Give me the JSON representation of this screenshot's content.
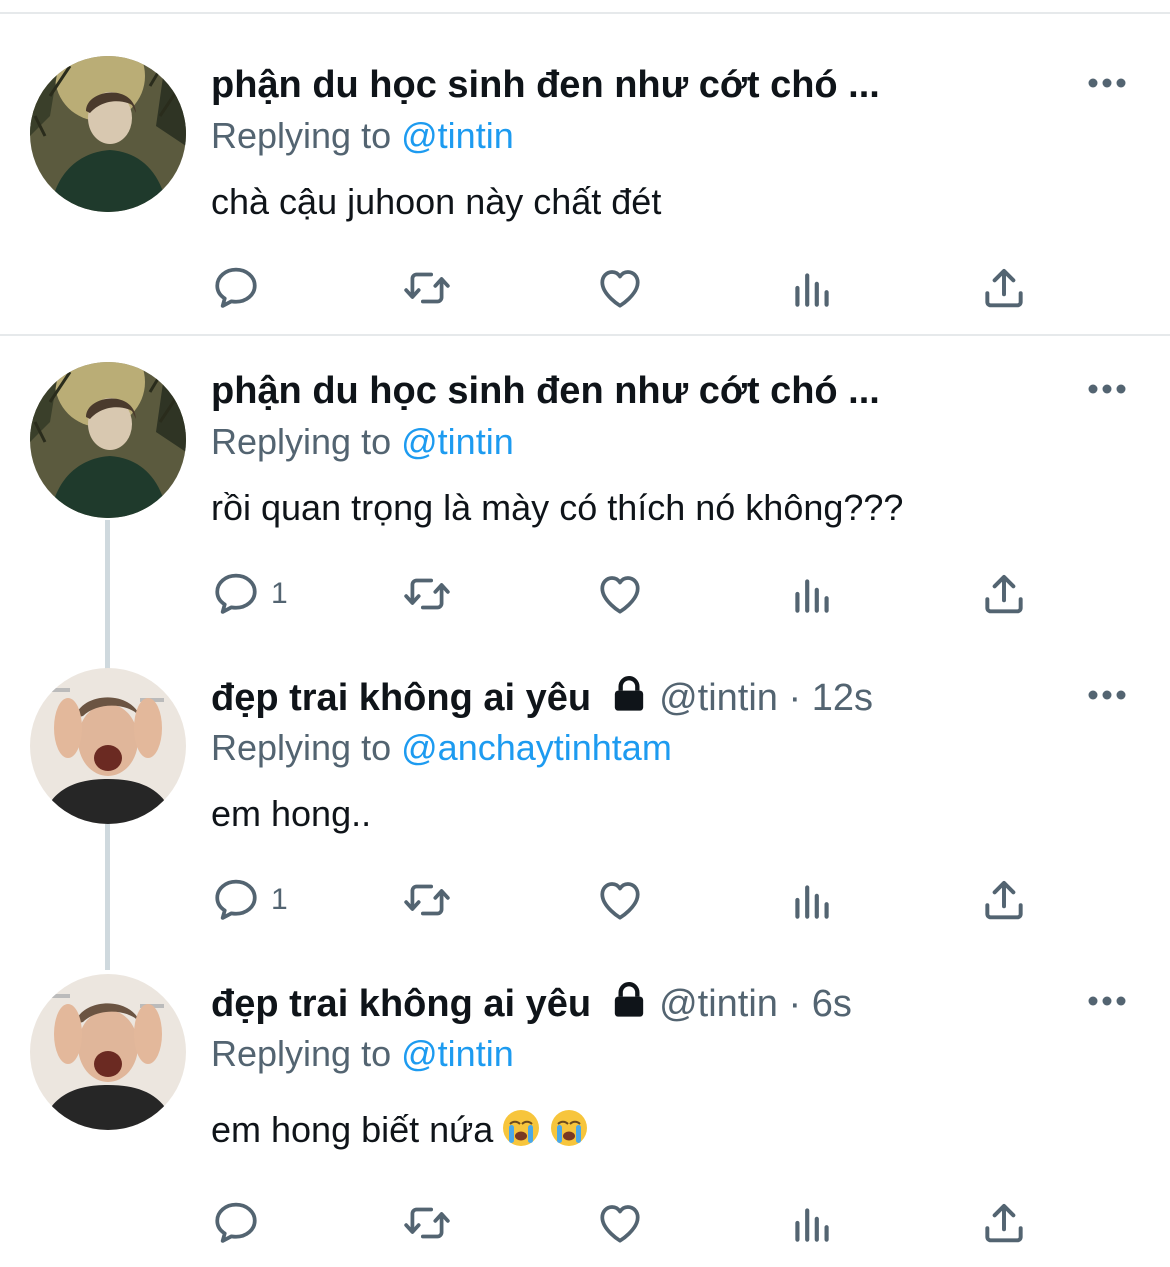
{
  "tweets": [
    {
      "display_name": "phận du học sinh đen như cớt chó ...",
      "handle": "",
      "time": "",
      "reply_label": "Replying to",
      "reply_to": "@tintin",
      "text": "chà cậu juhoon này chất đét",
      "reply_count": "",
      "locked": false,
      "avatar": "dark-hair-boy-in-forest"
    },
    {
      "display_name": "phận du học sinh đen như cớt chó ...",
      "handle": "",
      "time": "",
      "reply_label": "Replying to",
      "reply_to": "@tintin",
      "text": "rồi quan trọng là mày có thích nó không???",
      "reply_count": "1",
      "locked": false,
      "avatar": "dark-hair-boy-in-forest"
    },
    {
      "display_name": "đẹp trai không ai yêu",
      "handle": "@tintin",
      "time": "· 12s",
      "reply_label": "Replying to",
      "reply_to": "@anchaytinhtam",
      "text": "em hong..",
      "reply_count": "1",
      "locked": true,
      "avatar": "screaming-man"
    },
    {
      "display_name": "đẹp trai không ai yêu",
      "handle": "@tintin",
      "time": "· 6s",
      "reply_label": "Replying to",
      "reply_to": "@tintin",
      "text": "em hong biết nứa",
      "emoji": "loudly-crying-face x2",
      "reply_count": "",
      "locked": true,
      "avatar": "screaming-man"
    }
  ],
  "icons": [
    "reply-icon",
    "retweet-icon",
    "like-icon",
    "analytics-icon",
    "share-icon",
    "more-icon",
    "lock-icon"
  ],
  "colors": {
    "accent": "#1d9bf0",
    "secondary_text": "#536471",
    "icon": "#536471",
    "thread_line": "#cfd9de"
  }
}
